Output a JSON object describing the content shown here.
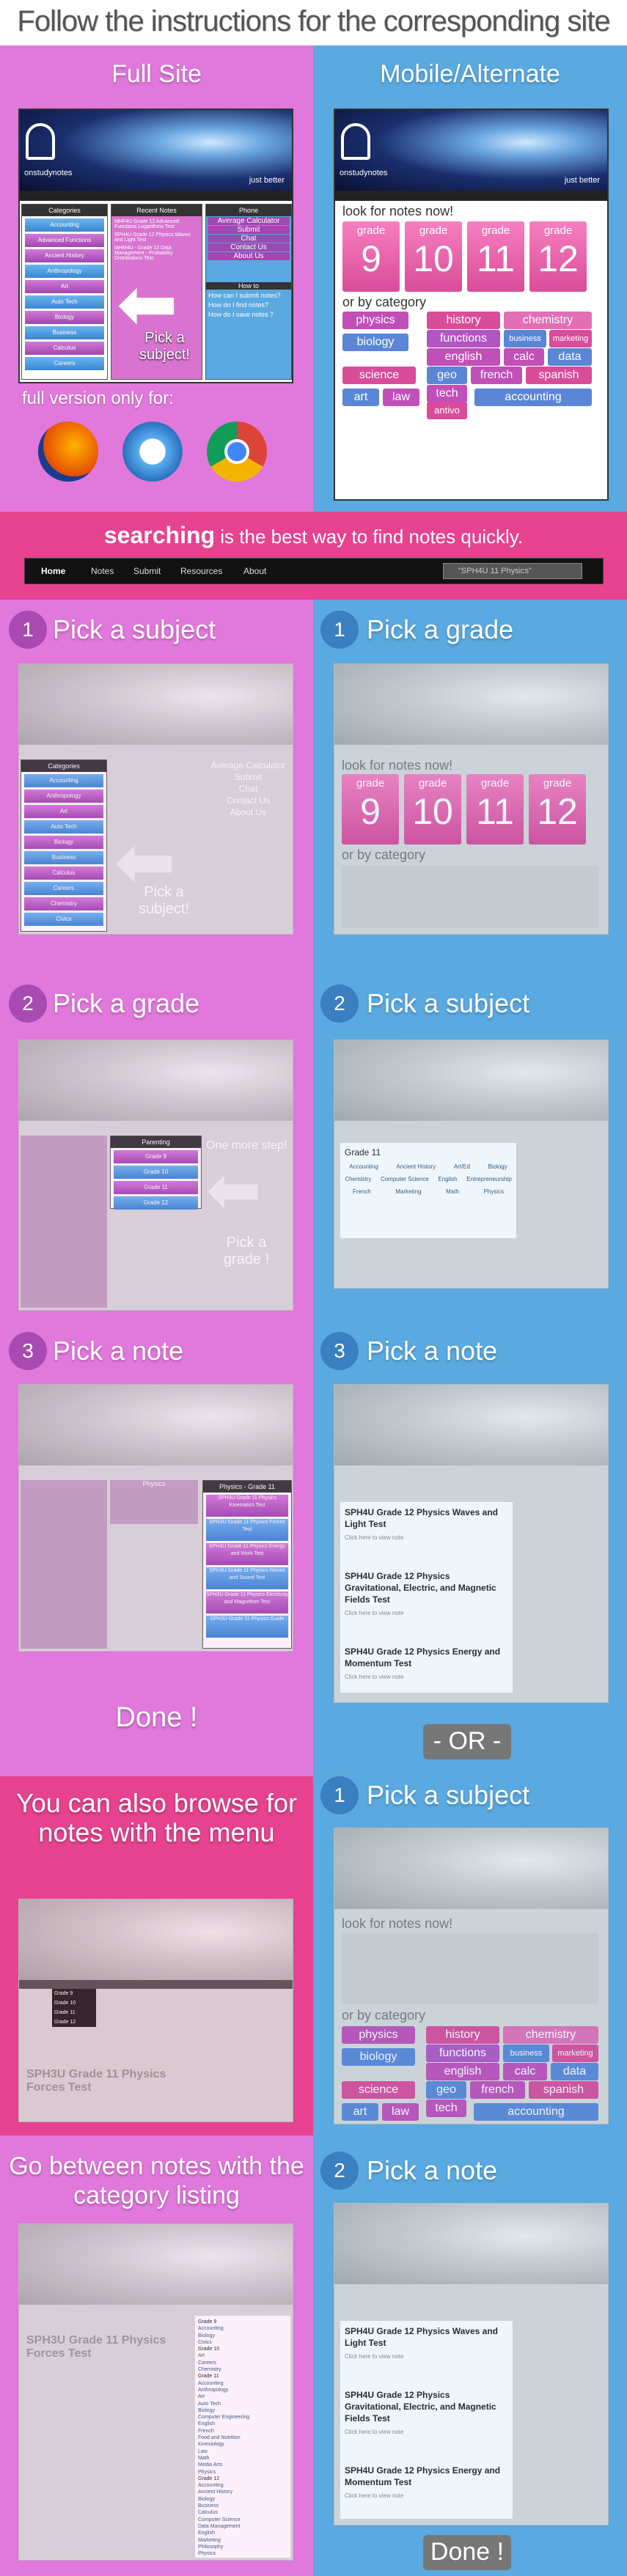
{
  "header": {
    "title": "Follow the instructions for the corresponding site"
  },
  "columns": {
    "full": "Full Site",
    "mobile": "Mobile/Alternate"
  },
  "site": {
    "brand": "onstudynotes",
    "tagline": "just better",
    "nav": [
      "Home",
      "Notes",
      "Submit",
      "Resources",
      "About"
    ]
  },
  "full_mock": {
    "categories_title": "Categories",
    "categories": [
      "Accounting",
      "Advanced Functions",
      "Ancient History",
      "Anthropology",
      "Art",
      "Auto Tech",
      "Biology",
      "Business",
      "Calculus",
      "Careers"
    ],
    "recent_title": "Recent Notes",
    "recent": [
      "MHF4U Grade 12 Advanced Functions Logarithms Test",
      "SPH4U Grade 12 Physics Waves and Light Test",
      "MHM4U - Grade 12 Data Management - Probability Distributions Test"
    ],
    "phone_title": "Phone",
    "phone": [
      "Average Calculator",
      "Submit",
      "Chat",
      "Contact Us",
      "About Us"
    ],
    "howto_title": "How to",
    "howto": [
      "How can I submit notes?",
      "How do I find notes?",
      "How do I save notes ?"
    ],
    "pick_label": "Pick a subject!"
  },
  "full_only": "full version only for:",
  "browsers": [
    "firefox-icon",
    "safari-icon",
    "chrome-icon"
  ],
  "mobile_mock": {
    "look_label": "look for notes now!",
    "grade_word": "grade",
    "grades": [
      "9",
      "10",
      "11",
      "12"
    ],
    "category_label": "or by category",
    "subjects": [
      "physics",
      "history",
      "chemistry",
      "biology",
      "functions",
      "business",
      "marketing",
      "english",
      "calc",
      "data",
      "science",
      "geo",
      "french",
      "spanish",
      "tech",
      "art",
      "law",
      "accounting",
      "antivo"
    ]
  },
  "search_text": {
    "bold": "searching",
    "rest": "is the best way to find notes quickly."
  },
  "searchbar": {
    "nav": [
      "Home",
      "Notes",
      "Submit",
      "Resources",
      "About"
    ],
    "placeholder": "\"SPH4U 11 Physics\""
  },
  "steps": {
    "full_1": {
      "num": "1",
      "label": "Pick a subject"
    },
    "mob_1": {
      "num": "1",
      "label": "Pick a grade"
    },
    "full_2": {
      "num": "2",
      "label": "Pick a grade"
    },
    "mob_2": {
      "num": "2",
      "label": "Pick a subject"
    },
    "full_3": {
      "num": "3",
      "label": "Pick a note"
    },
    "mob_3": {
      "num": "3",
      "label": "Pick a note"
    },
    "alt_1": {
      "num": "1",
      "label": "Pick a subject"
    },
    "alt_2": {
      "num": "2",
      "label": "Pick a note"
    }
  },
  "step1_menu": {
    "title": "Categories",
    "items": [
      "Accounting",
      "Anthropology",
      "Art",
      "Auto Tech",
      "Biology",
      "Business",
      "Calculus",
      "Careers",
      "Chemistry",
      "Civics"
    ],
    "pick_label": "Pick a subject!",
    "phone": [
      "Average Calculator",
      "Submit",
      "Chat",
      "Contact Us",
      "About Us"
    ]
  },
  "step2_menu": {
    "title": "Parenting",
    "items": [
      "Grade 9",
      "Grade 10",
      "Grade 11",
      "Grade 12"
    ],
    "hint": "One more step!",
    "pick_label": "Pick a grade !"
  },
  "step2_mob": {
    "title": "Grade 11",
    "rows": [
      [
        "Accounting",
        "Ancient History",
        "Art/Ed",
        "Biology"
      ],
      [
        "Chemistry",
        "Computer Science",
        "English",
        "Entrepreneurship"
      ],
      [
        "French",
        "Marketing",
        "Math",
        "Physics"
      ]
    ]
  },
  "step3_menu": {
    "title": "Physics - Grade 11",
    "items": [
      "SPH3U Grade 11 Physics Kinematics Test",
      "SPH3U Grade 11 Physics Forces Test",
      "SPH3U Grade 11 Physics Energy and Work Test",
      "SPH3U Grade 11 Physics Waves and Sound Test",
      "SPH3U Grade 11 Physics Electricity and Magnetism Test",
      "SPH3U Grade 11 Physics Guide"
    ],
    "left_title": "Physics"
  },
  "notes": [
    {
      "title": "SPH4U Grade 12 Physics Waves and Light Test",
      "more": "Click here to view note"
    },
    {
      "title": "SPH4U Grade 12 Physics Gravitational, Electric, and Magnetic Fields Test",
      "more": "Click here to view note"
    },
    {
      "title": "SPH4U Grade 12 Physics Energy and Momentum Test",
      "more": "Click here to view note"
    }
  ],
  "done": "Done !",
  "or": "- OR -",
  "browse_text": "You can also browse for notes with the menu",
  "browse_menu": [
    "Grade 9",
    "Grade 10",
    "Grade 11",
    "Grade 12"
  ],
  "doc_title": "SPH3U Grade 11 Physics Forces Test",
  "category_text": "Go between notes with the category listing",
  "sidebar_list": [
    "Grade 9",
    "Accounting",
    "Biology",
    "Civics",
    "Grade 10",
    "Art",
    "Careers",
    "Chemistry",
    "Grade 11",
    "Accounting",
    "Anthropology",
    "Art",
    "Auto Tech",
    "Biology",
    "Computer Engineering",
    "English",
    "French",
    "Food and Nutrition",
    "Kinesiology",
    "Law",
    "Math",
    "Media Arts",
    "Physics",
    "Grade 12",
    "Accounting",
    "Ancient History",
    "Biology",
    "Business",
    "Calculus",
    "Computer Science",
    "Data Management",
    "English",
    "Marketing",
    "Philosophy",
    "Physics"
  ],
  "done2": "Done !"
}
